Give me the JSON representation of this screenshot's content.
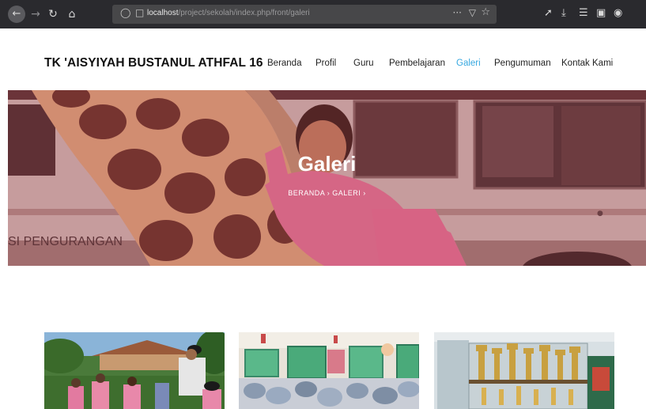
{
  "browser": {
    "url_host": "localhost",
    "url_path": "/project/sekolah/index.php/front/galeri",
    "more_glyph": "···"
  },
  "site": {
    "brand": "TK 'AISYIYAH BUSTANUL ATHFAL 16",
    "nav": [
      {
        "label": "Beranda",
        "active": false
      },
      {
        "label": "Profil",
        "active": false
      },
      {
        "label": "Guru",
        "active": false
      },
      {
        "label": "Pembelajaran",
        "active": false
      },
      {
        "label": "Galeri",
        "active": true
      },
      {
        "label": "Pengumuman",
        "active": false
      },
      {
        "label": "Kontak Kami",
        "active": false
      }
    ],
    "accent_color": "#36a8e0"
  },
  "hero": {
    "title": "Galeri",
    "breadcrumb_home": "BERANDA",
    "breadcrumb_sep": "›",
    "breadcrumb_current": "GALERI",
    "bus_text": "SI PENGURANGAN"
  },
  "gallery": {
    "items": [
      {
        "subject": "outdoor-activity"
      },
      {
        "subject": "classroom"
      },
      {
        "subject": "trophy-cabinet"
      }
    ]
  }
}
